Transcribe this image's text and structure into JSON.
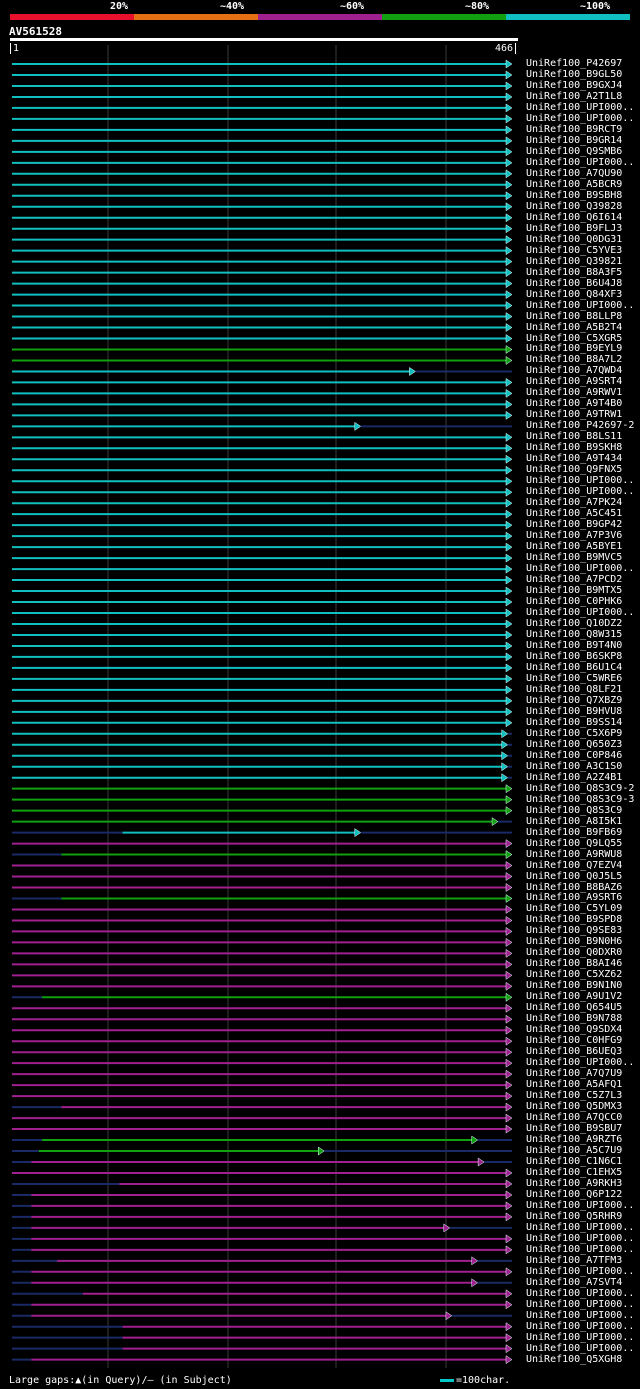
{
  "legend": {
    "labels": [
      "20%",
      "~40%",
      "~60%",
      "~80%",
      "~100%"
    ],
    "colors": [
      "#e8102a",
      "#e87014",
      "#a02090",
      "#10a010",
      "#10c0c0"
    ]
  },
  "query": {
    "name": "AV561528",
    "start": "1",
    "end": "466"
  },
  "footer": {
    "gaps_text": "Large gaps:▲(in Query)/– (in Subject)",
    "scale_text": "=100char."
  },
  "hits": [
    {
      "label": "UniRef100_P42697",
      "color": "cyan",
      "start": 0,
      "end": 466
    },
    {
      "label": "UniRef100_B9GL50",
      "color": "cyan",
      "start": 0,
      "end": 466
    },
    {
      "label": "UniRef100_B9GXJ4",
      "color": "cyan",
      "start": 0,
      "end": 466
    },
    {
      "label": "UniRef100_A2T1L8",
      "color": "cyan",
      "start": 0,
      "end": 466
    },
    {
      "label": "UniRef100_UPI000..",
      "color": "cyan",
      "start": 0,
      "end": 466
    },
    {
      "label": "UniRef100_UPI000..",
      "color": "cyan",
      "start": 0,
      "end": 466
    },
    {
      "label": "UniRef100_B9RCT9",
      "color": "cyan",
      "start": 0,
      "end": 466
    },
    {
      "label": "UniRef100_B9GR14",
      "color": "cyan",
      "start": 0,
      "end": 466
    },
    {
      "label": "UniRef100_Q9SMB6",
      "color": "cyan",
      "start": 0,
      "end": 466
    },
    {
      "label": "UniRef100_UPI000..",
      "color": "cyan",
      "start": 0,
      "end": 466
    },
    {
      "label": "UniRef100_A7QU90",
      "color": "cyan",
      "start": 0,
      "end": 466
    },
    {
      "label": "UniRef100_A5BCR9",
      "color": "cyan",
      "start": 0,
      "end": 466
    },
    {
      "label": "UniRef100_B9SBH8",
      "color": "cyan",
      "start": 0,
      "end": 466
    },
    {
      "label": "UniRef100_Q39828",
      "color": "cyan",
      "start": 0,
      "end": 466
    },
    {
      "label": "UniRef100_Q6I614",
      "color": "cyan",
      "start": 0,
      "end": 466
    },
    {
      "label": "UniRef100_B9FLJ3",
      "color": "cyan",
      "start": 0,
      "end": 466
    },
    {
      "label": "UniRef100_Q0DG31",
      "color": "cyan",
      "start": 0,
      "end": 466
    },
    {
      "label": "UniRef100_C5YVE3",
      "color": "cyan",
      "start": 0,
      "end": 466
    },
    {
      "label": "UniRef100_Q39821",
      "color": "cyan",
      "start": 0,
      "end": 466
    },
    {
      "label": "UniRef100_B8A3F5",
      "color": "cyan",
      "start": 0,
      "end": 466
    },
    {
      "label": "UniRef100_B6U4J8",
      "color": "cyan",
      "start": 0,
      "end": 466
    },
    {
      "label": "UniRef100_Q84XF3",
      "color": "cyan",
      "start": 0,
      "end": 466
    },
    {
      "label": "UniRef100_UPI000..",
      "color": "cyan",
      "start": 0,
      "end": 466
    },
    {
      "label": "UniRef100_B8LLP8",
      "color": "cyan",
      "start": 0,
      "end": 466
    },
    {
      "label": "UniRef100_A5B2T4",
      "color": "cyan",
      "start": 0,
      "end": 466
    },
    {
      "label": "UniRef100_C5XGR5",
      "color": "cyan",
      "start": 0,
      "end": 466
    },
    {
      "label": "UniRef100_B9EYL9",
      "color": "green",
      "start": 0,
      "end": 466
    },
    {
      "label": "UniRef100_B8A7L2",
      "color": "green",
      "start": 0,
      "end": 466
    },
    {
      "label": "UniRef100_A7QWD4",
      "color": "cyan",
      "start": 0,
      "end": 376
    },
    {
      "label": "UniRef100_A9SRT4",
      "color": "cyan",
      "start": 0,
      "end": 466
    },
    {
      "label": "UniRef100_A9RWV1",
      "color": "cyan",
      "start": 0,
      "end": 466
    },
    {
      "label": "UniRef100_A9T4B0",
      "color": "cyan",
      "start": 0,
      "end": 466
    },
    {
      "label": "UniRef100_A9TRW1",
      "color": "cyan",
      "start": 0,
      "end": 466
    },
    {
      "label": "UniRef100_P42697-2",
      "color": "cyan",
      "start": 0,
      "end": 325
    },
    {
      "label": "UniRef100_B8LS11",
      "color": "cyan",
      "start": 0,
      "end": 466
    },
    {
      "label": "UniRef100_B9SKH8",
      "color": "cyan",
      "start": 0,
      "end": 466
    },
    {
      "label": "UniRef100_A9T434",
      "color": "cyan",
      "start": 0,
      "end": 466
    },
    {
      "label": "UniRef100_Q9FNX5",
      "color": "cyan",
      "start": 0,
      "end": 466
    },
    {
      "label": "UniRef100_UPI000..",
      "color": "cyan",
      "start": 0,
      "end": 466
    },
    {
      "label": "UniRef100_UPI000..",
      "color": "cyan",
      "start": 0,
      "end": 466
    },
    {
      "label": "UniRef100_A7PK24",
      "color": "cyan",
      "start": 0,
      "end": 466
    },
    {
      "label": "UniRef100_A5C451",
      "color": "cyan",
      "start": 0,
      "end": 466
    },
    {
      "label": "UniRef100_B9GP42",
      "color": "cyan",
      "start": 0,
      "end": 466
    },
    {
      "label": "UniRef100_A7P3V6",
      "color": "cyan",
      "start": 0,
      "end": 466
    },
    {
      "label": "UniRef100_A5BYE1",
      "color": "cyan",
      "start": 0,
      "end": 466
    },
    {
      "label": "UniRef100_B9MVC5",
      "color": "cyan",
      "start": 0,
      "end": 466
    },
    {
      "label": "UniRef100_UPI000..",
      "color": "cyan",
      "start": 0,
      "end": 466
    },
    {
      "label": "UniRef100_A7PCD2",
      "color": "cyan",
      "start": 0,
      "end": 466
    },
    {
      "label": "UniRef100_B9MTX5",
      "color": "cyan",
      "start": 0,
      "end": 466
    },
    {
      "label": "UniRef100_C0PHK6",
      "color": "cyan",
      "start": 0,
      "end": 466
    },
    {
      "label": "UniRef100_UPI000..",
      "color": "cyan",
      "start": 0,
      "end": 466
    },
    {
      "label": "UniRef100_Q10DZ2",
      "color": "cyan",
      "start": 0,
      "end": 466
    },
    {
      "label": "UniRef100_Q8W315",
      "color": "cyan",
      "start": 0,
      "end": 466
    },
    {
      "label": "UniRef100_B9T4N0",
      "color": "cyan",
      "start": 0,
      "end": 466
    },
    {
      "label": "UniRef100_B6SKP8",
      "color": "cyan",
      "start": 0,
      "end": 466
    },
    {
      "label": "UniRef100_B6U1C4",
      "color": "cyan",
      "start": 0,
      "end": 466
    },
    {
      "label": "UniRef100_C5WRE6",
      "color": "cyan",
      "start": 0,
      "end": 466
    },
    {
      "label": "UniRef100_Q8LF21",
      "color": "cyan",
      "start": 0,
      "end": 466
    },
    {
      "label": "UniRef100_Q7XBZ9",
      "color": "cyan",
      "start": 0,
      "end": 466
    },
    {
      "label": "UniRef100_B9HVU8",
      "color": "cyan",
      "start": 0,
      "end": 466
    },
    {
      "label": "UniRef100_B9SS14",
      "color": "cyan",
      "start": 0,
      "end": 466
    },
    {
      "label": "UniRef100_C5X6P9",
      "color": "cyan",
      "start": 0,
      "end": 462
    },
    {
      "label": "UniRef100_Q650Z3",
      "color": "cyan",
      "start": 0,
      "end": 462
    },
    {
      "label": "UniRef100_C0P846",
      "color": "cyan",
      "start": 0,
      "end": 462
    },
    {
      "label": "UniRef100_A3C1S0",
      "color": "cyan",
      "start": 0,
      "end": 462
    },
    {
      "label": "UniRef100_A2Z4B1",
      "color": "cyan",
      "start": 0,
      "end": 462
    },
    {
      "label": "UniRef100_Q8S3C9-2",
      "color": "green",
      "start": 0,
      "end": 466
    },
    {
      "label": "UniRef100_Q8S3C9-3",
      "color": "green",
      "start": 0,
      "end": 466
    },
    {
      "label": "UniRef100_Q8S3C9",
      "color": "green",
      "start": 0,
      "end": 466
    },
    {
      "label": "UniRef100_A8I5K1",
      "color": "green",
      "start": 0,
      "end": 453
    },
    {
      "label": "UniRef100_B9FB69",
      "color": "cyan",
      "start": 103,
      "end": 325
    },
    {
      "label": "UniRef100_Q9LQ55",
      "color": "magenta",
      "start": 0,
      "end": 466
    },
    {
      "label": "UniRef100_A9RWU8",
      "color": "green",
      "start": 46,
      "end": 466
    },
    {
      "label": "UniRef100_Q7EZV4",
      "color": "magenta",
      "start": 0,
      "end": 466
    },
    {
      "label": "UniRef100_Q0J5L5",
      "color": "magenta",
      "start": 0,
      "end": 466
    },
    {
      "label": "UniRef100_B8BAZ6",
      "color": "magenta",
      "start": 0,
      "end": 466
    },
    {
      "label": "UniRef100_A9SRT6",
      "color": "green",
      "start": 46,
      "end": 466
    },
    {
      "label": "UniRef100_C5YL09",
      "color": "magenta",
      "start": 0,
      "end": 466
    },
    {
      "label": "UniRef100_B9SPD8",
      "color": "magenta",
      "start": 0,
      "end": 466
    },
    {
      "label": "UniRef100_Q9SE83",
      "color": "magenta",
      "start": 0,
      "end": 466
    },
    {
      "label": "UniRef100_B9N0H6",
      "color": "magenta",
      "start": 0,
      "end": 466
    },
    {
      "label": "UniRef100_Q0DXR0",
      "color": "magenta",
      "start": 0,
      "end": 466
    },
    {
      "label": "UniRef100_B8AI46",
      "color": "magenta",
      "start": 0,
      "end": 466
    },
    {
      "label": "UniRef100_C5XZ62",
      "color": "magenta",
      "start": 0,
      "end": 466
    },
    {
      "label": "UniRef100_B9N1N0",
      "color": "magenta",
      "start": 0,
      "end": 466
    },
    {
      "label": "UniRef100_A9U1V2",
      "color": "green",
      "start": 28,
      "end": 466
    },
    {
      "label": "UniRef100_Q654U5",
      "color": "magenta",
      "start": 0,
      "end": 466
    },
    {
      "label": "UniRef100_B9N788",
      "color": "magenta",
      "start": 0,
      "end": 466
    },
    {
      "label": "UniRef100_Q9SDX4",
      "color": "magenta",
      "start": 0,
      "end": 466
    },
    {
      "label": "UniRef100_C0HFG9",
      "color": "magenta",
      "start": 0,
      "end": 466
    },
    {
      "label": "UniRef100_B6UEQ3",
      "color": "magenta",
      "start": 0,
      "end": 466
    },
    {
      "label": "UniRef100_UPI000..",
      "color": "magenta",
      "start": 0,
      "end": 466
    },
    {
      "label": "UniRef100_A7Q7U9",
      "color": "magenta",
      "start": 0,
      "end": 466
    },
    {
      "label": "UniRef100_A5AFQ1",
      "color": "magenta",
      "start": 0,
      "end": 466
    },
    {
      "label": "UniRef100_C5Z7L3",
      "color": "magenta",
      "start": 0,
      "end": 466
    },
    {
      "label": "UniRef100_Q5DMX3",
      "color": "magenta",
      "start": 46,
      "end": 466
    },
    {
      "label": "UniRef100_A7QCC0",
      "color": "magenta",
      "start": 0,
      "end": 466
    },
    {
      "label": "UniRef100_B9SBU7",
      "color": "magenta",
      "start": 0,
      "end": 466
    },
    {
      "label": "UniRef100_A9RZT6",
      "color": "green",
      "start": 28,
      "end": 434
    },
    {
      "label": "UniRef100_A5C7U9",
      "color": "green",
      "start": 25,
      "end": 291
    },
    {
      "label": "UniRef100_C1N6C1",
      "color": "magenta",
      "start": 18,
      "end": 440
    },
    {
      "label": "UniRef100_C1EHX5",
      "color": "magenta",
      "start": 0,
      "end": 466
    },
    {
      "label": "UniRef100_A9RKH3",
      "color": "magenta",
      "start": 100,
      "end": 466
    },
    {
      "label": "UniRef100_Q6P122",
      "color": "magenta",
      "start": 18,
      "end": 466
    },
    {
      "label": "UniRef100_UPI000..",
      "color": "magenta",
      "start": 18,
      "end": 466
    },
    {
      "label": "UniRef100_Q5RHR9",
      "color": "magenta",
      "start": 18,
      "end": 466
    },
    {
      "label": "UniRef100_UPI000..",
      "color": "magenta",
      "start": 18,
      "end": 408
    },
    {
      "label": "UniRef100_UPI000..",
      "color": "magenta",
      "start": 18,
      "end": 466
    },
    {
      "label": "UniRef100_UPI000..",
      "color": "magenta",
      "start": 18,
      "end": 466
    },
    {
      "label": "UniRef100_A7TFM3",
      "color": "magenta",
      "start": 42,
      "end": 434
    },
    {
      "label": "UniRef100_UPI000..",
      "color": "magenta",
      "start": 18,
      "end": 466
    },
    {
      "label": "UniRef100_A7SVT4",
      "color": "magenta",
      "start": 18,
      "end": 434
    },
    {
      "label": "UniRef100_UPI000..",
      "color": "magenta",
      "start": 66,
      "end": 466
    },
    {
      "label": "UniRef100_UPI000..",
      "color": "magenta",
      "start": 18,
      "end": 466
    },
    {
      "label": "UniRef100_UPI000..",
      "color": "magenta",
      "start": 18,
      "end": 410
    },
    {
      "label": "UniRef100_UPI000..",
      "color": "magenta",
      "start": 103,
      "end": 466
    },
    {
      "label": "UniRef100_UPI000..",
      "color": "magenta",
      "start": 103,
      "end": 466
    },
    {
      "label": "UniRef100_UPI000..",
      "color": "magenta",
      "start": 103,
      "end": 466
    },
    {
      "label": "UniRef100_Q5XGH8",
      "color": "magenta",
      "start": 18,
      "end": 466
    }
  ]
}
